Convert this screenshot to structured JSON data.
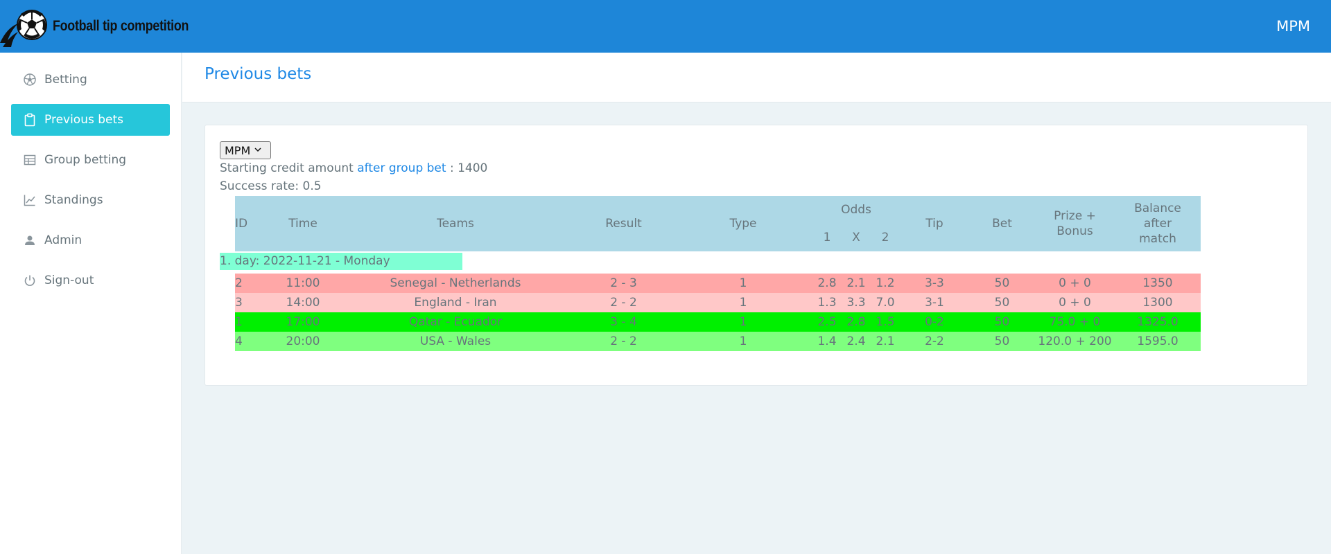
{
  "header": {
    "brand": "Football tip competition",
    "user": "MPM"
  },
  "sidebar": {
    "items": [
      {
        "label": "Betting",
        "icon": "football-icon"
      },
      {
        "label": "Previous bets",
        "icon": "clipboard-icon"
      },
      {
        "label": "Group betting",
        "icon": "table-icon"
      },
      {
        "label": "Standings",
        "icon": "chart-line-icon"
      },
      {
        "label": "Admin",
        "icon": "user-icon"
      },
      {
        "label": "Sign-out",
        "icon": "power-icon"
      }
    ],
    "active_index": 1
  },
  "page": {
    "title": "Previous bets"
  },
  "content": {
    "selected_user": "MPM",
    "credit_prefix": "Starting credit amount ",
    "credit_link": "after group bet",
    "credit_suffix": " : 1400",
    "success_rate": "Success rate: 0.5",
    "day_label": "1. day: 2022-11-21 - Monday"
  },
  "table": {
    "headers": {
      "id": "ID",
      "time": "Time",
      "teams": "Teams",
      "result": "Result",
      "type": "Type",
      "odds": "Odds",
      "odds_1": "1",
      "odds_x": "X",
      "odds_2": "2",
      "tip": "Tip",
      "bet": "Bet",
      "prize_1": "Prize +",
      "prize_2": "Bonus",
      "balance_1": "Balance",
      "balance_2": "after",
      "balance_3": "match"
    },
    "rows": [
      {
        "id": "2",
        "time": "11:00",
        "teams": "Senegal - Netherlands",
        "result": "2 - 3",
        "type": "1",
        "o1": "2.8",
        "ox": "2.1",
        "o2": "1.2",
        "tip": "3-3",
        "bet": "50",
        "prize": "0 + 0",
        "balance": "1350",
        "status": "red"
      },
      {
        "id": "3",
        "time": "14:00",
        "teams": "England - Iran",
        "result": "2 - 2",
        "type": "1",
        "o1": "1.3",
        "ox": "3.3",
        "o2": "7.0",
        "tip": "3-1",
        "bet": "50",
        "prize": "0 + 0",
        "balance": "1300",
        "status": "pink"
      },
      {
        "id": "1",
        "time": "17:00",
        "teams": "Qatar - Ecuador",
        "result": "3 - 4",
        "type": "1",
        "o1": "2.5",
        "ox": "2.8",
        "o2": "1.5",
        "tip": "0-2",
        "bet": "50",
        "prize": "75.0 + 0",
        "balance": "1325.0",
        "status": "green"
      },
      {
        "id": "4",
        "time": "20:00",
        "teams": "USA - Wales",
        "result": "2 - 2",
        "type": "1",
        "o1": "1.4",
        "ox": "2.4",
        "o2": "2.1",
        "tip": "2-2",
        "bet": "50",
        "prize": "120.0 + 200",
        "balance": "1595.0",
        "status": "lightgreen"
      }
    ]
  },
  "colors": {
    "topbar": "#1e86d8",
    "active_nav": "#26c6da",
    "header_row": "#add8e6",
    "day_row": "#7fffd4",
    "row_red": "#ffa7a7",
    "row_pink": "#ffc8c8",
    "row_green": "#00f000",
    "row_lightgreen": "#7fff7f"
  }
}
